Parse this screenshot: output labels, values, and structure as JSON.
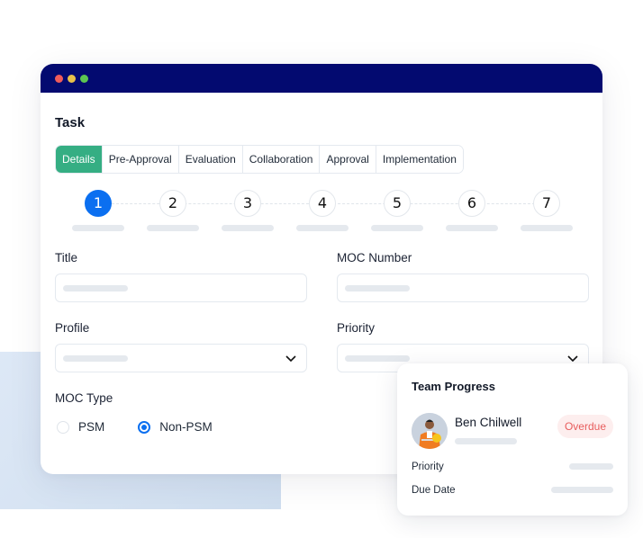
{
  "window": {
    "title": "Task",
    "controls": [
      "close",
      "minimize",
      "maximize"
    ]
  },
  "tabs": [
    {
      "label": "Details",
      "active": true
    },
    {
      "label": "Pre-Approval",
      "active": false
    },
    {
      "label": "Evaluation",
      "active": false
    },
    {
      "label": "Collaboration",
      "active": false
    },
    {
      "label": "Approval",
      "active": false
    },
    {
      "label": "Implementation",
      "active": false
    }
  ],
  "stepper": {
    "current": 1,
    "steps": [
      "1",
      "2",
      "3",
      "4",
      "5",
      "6",
      "7"
    ]
  },
  "form": {
    "title_label": "Title",
    "moc_number_label": "MOC Number",
    "profile_label": "Profile",
    "priority_label": "Priority",
    "moc_type_label": "MOC Type",
    "moc_type_options": [
      {
        "label": "PSM",
        "checked": false
      },
      {
        "label": "Non-PSM",
        "checked": true
      }
    ]
  },
  "team_progress": {
    "title": "Team Progress",
    "person_name": "Ben Chilwell",
    "status": "Overdue",
    "rows": [
      {
        "label": "Priority"
      },
      {
        "label": "Due Date"
      }
    ]
  },
  "colors": {
    "titlebar": "#030a70",
    "active_tab": "#35ae83",
    "active_step": "#0b6ff0",
    "radio_checked": "#0b6ff0",
    "overdue_text": "#e85d5d",
    "overdue_bg": "#fdeeee"
  }
}
